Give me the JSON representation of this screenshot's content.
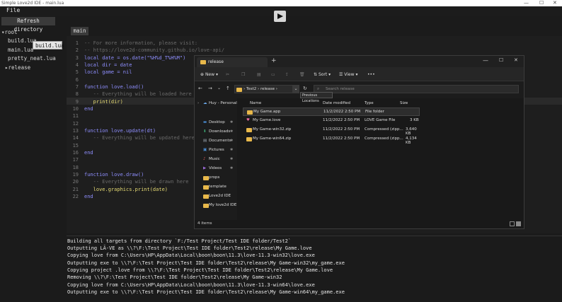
{
  "app": {
    "title": "Simple Love2d IDE - main.lua",
    "menu_file": "File"
  },
  "sidebar": {
    "refresh_label": "Refresh directory",
    "root_label": "▾root",
    "items": [
      "build.lua",
      "main.lua",
      "pretty_neat.lua",
      "▸release"
    ],
    "tooltip": "build.lua"
  },
  "editor": {
    "tab": "main",
    "line_numbers": [
      "1",
      "2",
      "3",
      "4",
      "5",
      "6",
      "7",
      "8",
      "9",
      "10",
      "11",
      "12",
      "13",
      "14",
      "15",
      "16",
      "17",
      "18",
      "19",
      "20",
      "21",
      "22"
    ],
    "lines": [
      "-- For more information, please visit:",
      "-- https://love2d-community.github.io/love-api/",
      "local date = os.date(\"%H%d_T%H%M\")",
      "local dir = date",
      "local game = nil",
      "",
      "function love.load()",
      "   -- Everything will be loaded here",
      "   print(dir)",
      "end",
      "",
      "",
      "function love.update(dt)",
      "   -- Everything will be updated here",
      "",
      "end",
      "",
      "",
      "function love.draw()",
      "   -- Everything will be drawn here",
      "   love.graphics.print(date)",
      "end"
    ]
  },
  "output": {
    "lines": [
      "Building all targets from directory `F:/Test Project/Test IDE folder/Test2`",
      "Outputting LÃ-VE as \\\\?\\F:\\Test Project\\Test IDE folder\\Test2\\release\\My Game.love",
      "Copying love from C:\\Users\\HP\\AppData\\Local\\boon\\boon\\11.3\\love-11.3-win32\\love.exe",
      "Outputting exe to \\\\?\\F:\\Test Project\\Test IDE folder\\Test2\\release\\My Game-win32\\my_game.exe",
      "Copying project .love from \\\\?\\F:\\Test Project\\Test IDE folder\\Test2\\release\\My Game.love",
      "Removing \\\\?\\F:\\Test Project\\Test IDE folder\\Test2\\release\\My Game-win32",
      "Copying love from C:\\Users\\HP\\AppData\\Local\\boon\\boon\\11.3\\love-11.3-win64\\love.exe",
      "Outputting exe to \\\\?\\F:\\Test Project\\Test IDE folder\\Test2\\release\\My Game-win64\\my_game.exe"
    ]
  },
  "explorer": {
    "tab_title": "release",
    "new_label": "New",
    "sort_label": "Sort",
    "view_label": "View",
    "breadcrumb_1": "Test2",
    "breadcrumb_2": "release",
    "search_placeholder": "Search release",
    "tooltip": "Previous Locations",
    "nav": [
      "Huy - Personal",
      "Desktop",
      "Downloads",
      "Documents",
      "Pictures",
      "Music",
      "Videos",
      "props",
      "template",
      "Love2d IDE",
      "My love2d IDE"
    ],
    "columns": {
      "name": "Name",
      "date": "Date modified",
      "type": "Type",
      "size": "Size"
    },
    "files": [
      {
        "name": "My Game.app",
        "date": "11/2/2022 2:50 PM",
        "type": "File folder",
        "size": ""
      },
      {
        "name": "My Game.love",
        "date": "11/2/2022 2:50 PM",
        "type": "LOVE Game File",
        "size": "3 KB"
      },
      {
        "name": "My Game-win32.zip",
        "date": "11/2/2022 2:50 PM",
        "type": "Compressed (zipp...",
        "size": "3,640 KB"
      },
      {
        "name": "My Game-win64.zip",
        "date": "11/2/2022 2:50 PM",
        "type": "Compressed (zipp...",
        "size": "4,134 KB"
      }
    ],
    "status": "4 items"
  }
}
